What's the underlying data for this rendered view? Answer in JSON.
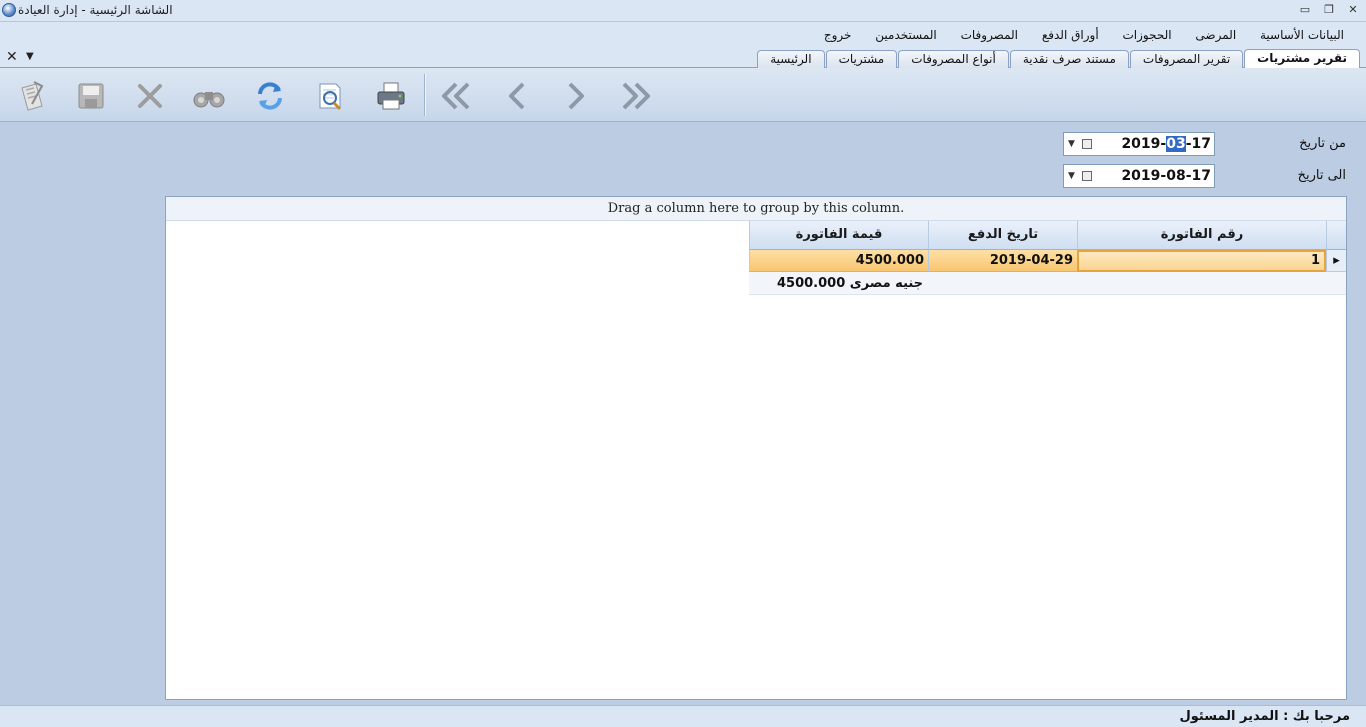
{
  "window": {
    "title": "الشاشة الرئيسية - إدارة العيادة",
    "minimize": "▭",
    "maximize": "❐",
    "close": "✕"
  },
  "menu": [
    "البيانات الأساسية",
    "المرضى",
    "الحجوزات",
    "أوراق الدفع",
    "المصروفات",
    "المستخدمين",
    "خروج"
  ],
  "tabs": {
    "close_glyph": "✕",
    "menu_glyph": "▼",
    "items": [
      "تقرير مشتريات",
      "تقرير المصروفات",
      "مستند صرف نقدية",
      "أنواع المصروفات",
      "مشتريات",
      "الرئيسية"
    ],
    "active_index": 0
  },
  "toolbar": {
    "icons": [
      "checklist-icon",
      "save-icon",
      "delete-icon",
      "binoculars-icon",
      "refresh-icon",
      "preview-icon",
      "print-icon",
      "first-record-icon",
      "previous-record-icon",
      "next-record-icon",
      "last-record-icon"
    ]
  },
  "filters": {
    "from_label": "من تاريخ",
    "to_label": "الى تاريخ",
    "from_date": {
      "year": "2019",
      "month": "03",
      "day": "17"
    },
    "to_date": {
      "year": "2019",
      "month": "08",
      "day": "17"
    },
    "dropdown_glyph": "▼",
    "separator": "-"
  },
  "grid": {
    "group_hint": "Drag a column here to group by this column.",
    "columns": [
      "رقم الفاتورة",
      "تاريخ الدفع",
      "قيمة الفاتورة"
    ],
    "rows": [
      {
        "invoice_no": "1",
        "payment_date": "2019-04-29",
        "invoice_value": "4500.000"
      }
    ],
    "row_indicator": "▸",
    "total": "4500.000 جنيه مصرى"
  },
  "status": {
    "welcome": "مرحبا بك :  المدير المسئول"
  },
  "colors": {
    "accent_selection": "#316ac5",
    "selected_row": "#f9c670",
    "background": "#bccde3"
  }
}
